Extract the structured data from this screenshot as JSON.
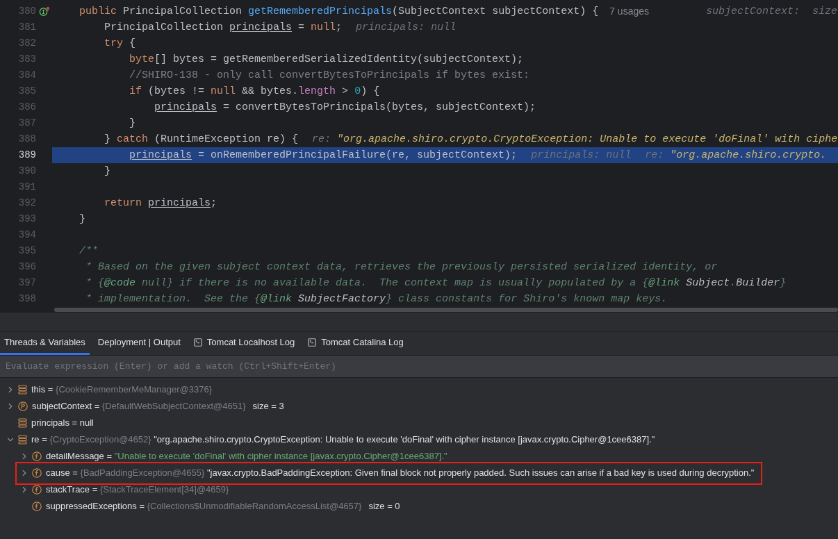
{
  "editor": {
    "lines": [
      {
        "number": "380",
        "current": false,
        "marker": true,
        "tokens": [
          {
            "kind": "k",
            "text": "    public "
          },
          {
            "kind": "t",
            "text": "PrincipalCollection "
          },
          {
            "kind": "m",
            "text": "getRememberedPrincipals"
          },
          {
            "kind": "t",
            "text": "(SubjectContext subjectContext) {"
          },
          {
            "kind": "u",
            "text": "7 usages"
          },
          {
            "kind": "hf",
            "text": "subjectContext:  size"
          }
        ]
      },
      {
        "number": "381",
        "current": false,
        "marker": false,
        "tokens": [
          {
            "kind": "t",
            "text": "        PrincipalCollection "
          },
          {
            "kind": "v",
            "text": "principals"
          },
          {
            "kind": "t",
            "text": " = "
          },
          {
            "kind": "k",
            "text": "null"
          },
          {
            "kind": "t",
            "text": ";"
          },
          {
            "kind": "h",
            "text": "principals: null"
          }
        ]
      },
      {
        "number": "382",
        "current": false,
        "marker": false,
        "tokens": [
          {
            "kind": "k",
            "text": "        try"
          },
          {
            "kind": "t",
            "text": " {"
          }
        ]
      },
      {
        "number": "383",
        "current": false,
        "marker": false,
        "tokens": [
          {
            "kind": "k",
            "text": "            byte"
          },
          {
            "kind": "t",
            "text": "[] bytes = getRememberedSerializedIdentity(subjectContext);"
          }
        ]
      },
      {
        "number": "384",
        "current": false,
        "marker": false,
        "tokens": [
          {
            "kind": "c",
            "text": "            //SHIRO-138 - only call convertBytesToPrincipals if bytes exist:"
          }
        ]
      },
      {
        "number": "385",
        "current": false,
        "marker": false,
        "tokens": [
          {
            "kind": "k",
            "text": "            if"
          },
          {
            "kind": "t",
            "text": " (bytes != "
          },
          {
            "kind": "k",
            "text": "null"
          },
          {
            "kind": "t",
            "text": " && bytes."
          },
          {
            "kind": "f",
            "text": "length"
          },
          {
            "kind": "t",
            "text": " > "
          },
          {
            "kind": "n",
            "text": "0"
          },
          {
            "kind": "t",
            "text": ") {"
          }
        ]
      },
      {
        "number": "386",
        "current": false,
        "marker": false,
        "tokens": [
          {
            "kind": "v",
            "text": "                principals"
          },
          {
            "kind": "t",
            "text": " = convertBytesToPrincipals(bytes, subjectContext);"
          }
        ]
      },
      {
        "number": "387",
        "current": false,
        "marker": false,
        "tokens": [
          {
            "kind": "t",
            "text": "            }"
          }
        ]
      },
      {
        "number": "388",
        "current": false,
        "marker": false,
        "tokens": [
          {
            "kind": "t",
            "text": "        } "
          },
          {
            "kind": "k",
            "text": "catch"
          },
          {
            "kind": "t",
            "text": " (RuntimeException re) {"
          },
          {
            "kind": "h",
            "text": "re: "
          },
          {
            "kind": "hs",
            "text": "\"org.apache.shiro.crypto.CryptoException: Unable to execute 'doFinal' with ciphe"
          }
        ]
      },
      {
        "number": "389",
        "current": true,
        "marker": false,
        "tokens": [
          {
            "kind": "v",
            "text": "            principals"
          },
          {
            "kind": "t",
            "text": " = onRememberedPrincipalFailure(re, subjectContext);"
          },
          {
            "kind": "h",
            "text": "principals: null"
          },
          {
            "kind": "h",
            "text": "re: "
          },
          {
            "kind": "hs",
            "text": "\"org.apache.shiro.crypto."
          }
        ]
      },
      {
        "number": "390",
        "current": false,
        "marker": false,
        "tokens": [
          {
            "kind": "t",
            "text": "        }"
          }
        ]
      },
      {
        "number": "391",
        "current": false,
        "marker": false
      },
      {
        "number": "392",
        "current": false,
        "marker": false,
        "tokens": [
          {
            "kind": "k",
            "text": "        return "
          },
          {
            "kind": "v",
            "text": "principals"
          },
          {
            "kind": "t",
            "text": ";"
          }
        ]
      },
      {
        "number": "393",
        "current": false,
        "marker": false,
        "tokens": [
          {
            "kind": "t",
            "text": "    }"
          }
        ]
      },
      {
        "number": "394",
        "current": false,
        "marker": false
      },
      {
        "number": "395",
        "current": false,
        "marker": false,
        "tokens": [
          {
            "kind": "d",
            "text": "    /**"
          }
        ]
      },
      {
        "number": "396",
        "current": false,
        "marker": false,
        "tokens": [
          {
            "kind": "d",
            "text": "     * Based on the given subject context data, retrieves the previously persisted serialized identity, or"
          }
        ]
      },
      {
        "number": "397",
        "current": false,
        "marker": false,
        "tokens": [
          {
            "kind": "d",
            "text": "     * {"
          },
          {
            "kind": "dt",
            "text": "@code"
          },
          {
            "kind": "d",
            "text": " null} if there is no available data.  The context map is usually populated by a {"
          },
          {
            "kind": "dt",
            "text": "@link"
          },
          {
            "kind": "dl",
            "text": " Subject"
          },
          {
            "kind": "d",
            "text": "."
          },
          {
            "kind": "dl",
            "text": "Builder"
          },
          {
            "kind": "d",
            "text": "}"
          }
        ]
      },
      {
        "number": "398",
        "current": false,
        "marker": false,
        "tokens": [
          {
            "kind": "d",
            "text": "     * implementation.  See the {"
          },
          {
            "kind": "dt",
            "text": "@link"
          },
          {
            "kind": "dl",
            "text": " SubjectFactory"
          },
          {
            "kind": "d",
            "text": "} class constants for Shiro's known map keys."
          }
        ]
      }
    ]
  },
  "debug_panel": {
    "tabs": [
      {
        "label": "Threads & Variables",
        "selected": true,
        "kind": "plain"
      },
      {
        "label": "Deployment | Output",
        "selected": false,
        "kind": "plain"
      },
      {
        "label": "Tomcat Localhost Log",
        "selected": false,
        "kind": "log"
      },
      {
        "label": "Tomcat Catalina Log",
        "selected": false,
        "kind": "log"
      }
    ],
    "evaluate_field": {
      "placeholder": "Evaluate expression (Enter) or add a watch (Ctrl+Shift+Enter)"
    },
    "variables": [
      {
        "expanded": false,
        "kind": "local",
        "name": "this",
        "separator": "=",
        "type": "{CookieRememberMeManager@3376}",
        "highlighted": false
      },
      {
        "expanded": false,
        "kind": "param",
        "name": "subjectContext",
        "separator": "=",
        "type": "{DefaultWebSubjectContext@4651}",
        "extra": "size = 3",
        "highlighted": false
      },
      {
        "kind": "local",
        "name": "principals",
        "separator": "=",
        "value": "null",
        "is_string": false,
        "highlighted": false
      },
      {
        "expanded": true,
        "kind": "local",
        "name": "re",
        "separator": "=",
        "type": "{CryptoException@4652}",
        "value": "\"org.apache.shiro.crypto.CryptoException: Unable to execute 'doFinal' with cipher instance [javax.crypto.Cipher@1cee6387].\"",
        "is_string": false,
        "highlighted": false,
        "children": [
          {
            "expanded": false,
            "kind": "field",
            "name": "detailMessage",
            "separator": "=",
            "value": "\"Unable to execute 'doFinal' with cipher instance [javax.crypto.Cipher@1cee6387].\"",
            "is_string": true,
            "highlighted": false
          },
          {
            "expanded": false,
            "kind": "field",
            "name": "cause",
            "separator": "=",
            "type": "{BadPaddingException@4655}",
            "value": "\"javax.crypto.BadPaddingException: Given final block not properly padded. Such issues can arise if a bad key is used during decryption.\"",
            "is_string": false,
            "highlighted": true
          },
          {
            "expanded": false,
            "kind": "field",
            "name": "stackTrace",
            "separator": "=",
            "type": "{StackTraceElement[34]@4659}",
            "highlighted": false
          },
          {
            "kind": "field",
            "name": "suppressedExceptions",
            "separator": "=",
            "type": "{Collections$UnmodifiableRandomAccessList@4657}",
            "extra": "size = 0",
            "highlighted": false
          }
        ]
      }
    ]
  }
}
